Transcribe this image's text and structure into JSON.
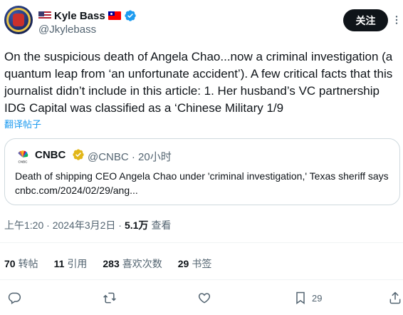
{
  "author": {
    "display_name": "Kyle Bass",
    "handle": "@Jkylebass",
    "follow_label": "关注"
  },
  "tweet": {
    "text": "On the suspicious death of Angela Chao...now a criminal investigation (a quantum leap from ‘an unfortunate accident’). A few critical facts that this journalist didn’t include in this article: 1. Her husband’s VC partnership IDG Capital was classified as a ‘Chinese Military 1/9",
    "translate_label": "翻译帖子"
  },
  "quote": {
    "logo_text": "CNBC",
    "name": "CNBC",
    "meta": "@CNBC · 20小时",
    "text": "Death of shipping CEO Angela Chao under 'criminal investigation,' Texas sheriff says cnbc.com/2024/02/29/ang..."
  },
  "timestamp": {
    "time": "上午1:20 · 2024年3月2日 ·",
    "views_num": "5.1万",
    "views_label": "查看"
  },
  "stats": [
    {
      "num": "70",
      "label": "转帖"
    },
    {
      "num": "11",
      "label": "引用"
    },
    {
      "num": "283",
      "label": "喜欢次数"
    },
    {
      "num": "29",
      "label": "书签"
    }
  ],
  "actions": {
    "bookmark_count": "29"
  },
  "colors": {
    "accent": "#1d9bf0",
    "text": "#0f1419",
    "secondary": "#536471",
    "border": "#cfd9de",
    "gold": "#e2b719"
  },
  "icons": [
    "verified-badge-icon",
    "more-icon",
    "reply-icon",
    "retweet-icon",
    "like-icon",
    "bookmark-icon",
    "share-icon",
    "gold-verified-icon"
  ]
}
